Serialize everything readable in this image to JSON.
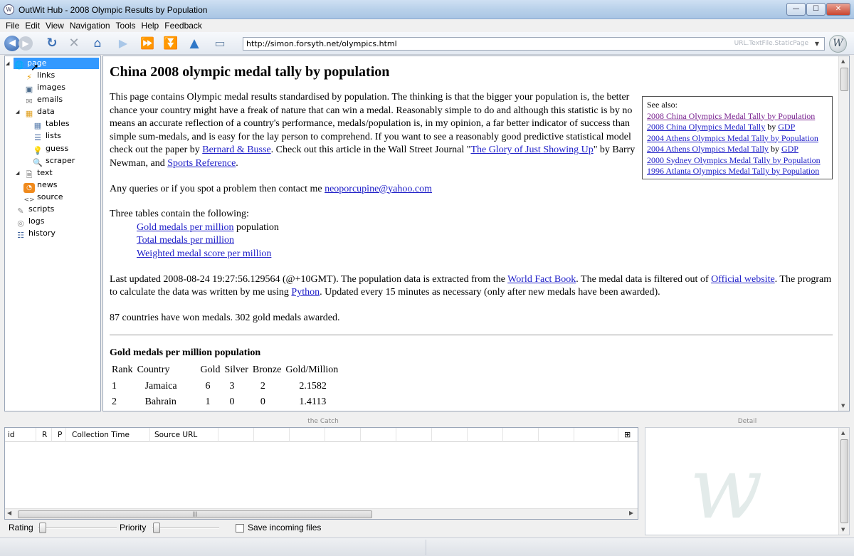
{
  "window": {
    "title": "OutWit Hub - 2008 Olympic Results by Population",
    "min_label": "—",
    "max_label": "☐",
    "close_label": "✕"
  },
  "menu": [
    "File",
    "Edit",
    "View",
    "Navigation",
    "Tools",
    "Help",
    "Feedback"
  ],
  "toolbar": {
    "url": "http://simon.forsyth.net/olympics.html",
    "url_hint": "URL.TextFile.StaticPage"
  },
  "sidebar": {
    "items": [
      {
        "label": "page",
        "icon": "globe-icon"
      },
      {
        "label": "links",
        "icon": "lightning-icon"
      },
      {
        "label": "images",
        "icon": "image-icon"
      },
      {
        "label": "emails",
        "icon": "envelope-icon"
      },
      {
        "label": "data",
        "icon": "table-folder-icon"
      },
      {
        "label": "tables",
        "icon": "table-icon"
      },
      {
        "label": "lists",
        "icon": "list-icon"
      },
      {
        "label": "guess",
        "icon": "lightbulb-icon"
      },
      {
        "label": "scraper",
        "icon": "magnifier-icon"
      },
      {
        "label": "text",
        "icon": "document-icon"
      },
      {
        "label": "news",
        "icon": "rss-icon"
      },
      {
        "label": "source",
        "icon": "code-icon"
      },
      {
        "label": "scripts",
        "icon": "script-icon"
      },
      {
        "label": "logs",
        "icon": "log-icon"
      },
      {
        "label": "history",
        "icon": "numbered-list-icon"
      }
    ]
  },
  "content": {
    "heading": "China 2008 olympic medal tally by population",
    "intro_1": "This page contains Olympic medal results standardised by population. The thinking is that the bigger your population is, the better chance your country might have a freak of nature that can win a medal. Reasonably simple to do and although this statistic is by no means an accurate reflection of a country's performance, medals/population is, in my opinion, a far better indicator of success than simple sum-medals, and is easy for the lay person to comprehend. If you want to see a reasonably good predictive statistical model check out the paper by ",
    "link_bernard": "Bernard & Busse",
    "intro_2": ". Check out this article in the Wall Street Journal \"",
    "link_glory": "The Glory of Just Showing Up",
    "intro_3": "\" by Barry Newman, and ",
    "link_sports": "Sports Reference",
    "intro_4": ".",
    "queries_text": "Any queries or if you spot a problem then contact me ",
    "email": "neoporcupine@yahoo.com",
    "three_tables": "Three tables contain the following:",
    "toc_gold": "Gold medals per million",
    "toc_gold_suffix": " population",
    "toc_total": "Total medals per million",
    "toc_weighted": "Weighted medal score per million",
    "updated_1": "Last updated 2008-08-24 19:27:56.129564 (@+10GMT). The population data is extracted from the ",
    "link_factbook": "World Fact Book",
    "updated_2": ". The medal data is filtered out of ",
    "link_official": "Official website",
    "updated_3": ". The program to calculate the data was written by me using ",
    "link_python": "Python",
    "updated_4": ". Updated every 15 minutes as necessary (only after new medals have been awarded).",
    "countries_summary": "87 countries have won medals. 302 gold medals awarded.",
    "see_also": {
      "title": "See also:",
      "link1": "2008 China Olympics Medal Tally by Population",
      "link2": "2008 China Olympics Medal Tally",
      "link2_mid": " by ",
      "link2_gdp": "GDP",
      "link3": "2004 Athens Olympics Medal Tally by Population",
      "link4": "2004 Athens Olympics Medal Tally",
      "link4_mid": " by ",
      "link4_gdp": "GDP",
      "link5": "2000 Sydney Olympics Medal Tally by Population",
      "link6": "1996 Atlanta Olympics Medal Tally by Population"
    },
    "gold_table": {
      "title": "Gold medals per million population",
      "headers": [
        "Rank",
        "Country",
        "Gold",
        "Silver",
        "Bronze",
        "Gold/Million"
      ],
      "rows": [
        [
          "1",
          "Jamaica",
          "6",
          "3",
          "2",
          "2.1582"
        ],
        [
          "2",
          "Bahrain",
          "1",
          "0",
          "0",
          "1.4113"
        ]
      ]
    }
  },
  "catch": {
    "header": "the Catch",
    "columns": [
      "id",
      "R",
      "P",
      "Collection Time",
      "Source URL"
    ]
  },
  "detail": {
    "header": "Detail"
  },
  "bottom": {
    "rating_label": "Rating",
    "priority_label": "Priority",
    "save_label": "Save incoming files"
  }
}
